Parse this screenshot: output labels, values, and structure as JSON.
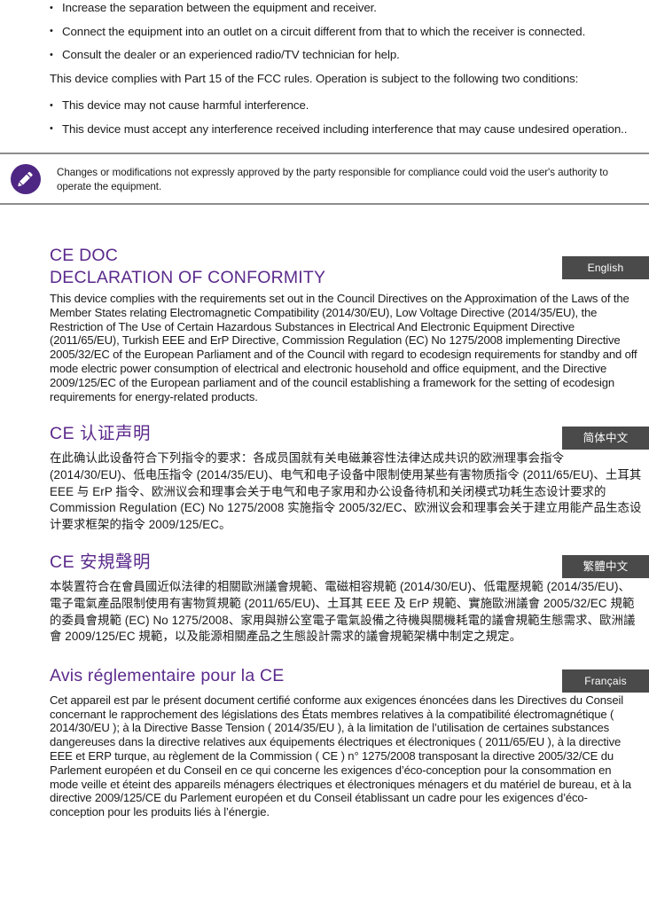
{
  "fcc": {
    "bullets": [
      "Increase the separation between the equipment and receiver.",
      "Connect the equipment into an outlet on a circuit different from that to which the receiver is connected.",
      "Consult the dealer or an experienced radio/TV technician for help."
    ],
    "compliance_paragraph": "This device complies with Part 15 of the FCC rules. Operation is subject to the following two conditions:",
    "conditions": [
      "This device may not cause harmful interference.",
      "This device must accept any interference received including interference that may cause undesired operation.."
    ]
  },
  "note": {
    "icon": "pencil-icon",
    "icon_background": "#4e2683",
    "text": "Changes or modifications not expressly approved by the party responsible for compliance could void the user's authority to operate the equipment."
  },
  "colors": {
    "heading_purple": "#5b2a8c",
    "badge_gray": "#4a4a4a",
    "rule_gray": "#8d8d8d"
  },
  "sections": [
    {
      "id": "ce-doc-english",
      "title_line1": "CE DOC",
      "title_line2": "DECLARATION OF CONFORMITY",
      "badge": "English",
      "body": "This device complies with the requirements set out in the Council Directives on the Approximation of the Laws of the Member States relating Electromagnetic Compatibility (2014/30/EU), Low Voltage Directive (2014/35/EU), the Restriction of The Use of Certain Hazardous Substances in Electrical And Electronic Equipment Directive (2011/65/EU), Turkish EEE and ErP Directive, Commission Regulation (EC) No 1275/2008 implementing Directive 2005/32/EC of the European Parliament and of the Council with regard to ecodesign requirements for standby and off mode electric power consumption of electrical and electronic household and office equipment, and the Directive 2009/125/EC of the European parliament and of the council establishing a framework for the setting of ecodesign requirements for energy-related products."
    },
    {
      "id": "ce-doc-simplified-chinese",
      "title": "CE 认证声明",
      "badge": "简体中文",
      "body": "在此确认此设备符合下列指令的要求：各成员国就有关电磁兼容性法律达成共识的欧洲理事会指令 (2014/30/EU)、低电压指令 (2014/35/EU)、电气和电子设备中限制使用某些有害物质指令 (2011/65/EU)、土耳其 EEE 与 ErP 指令、欧洲议会和理事会关于电气和电子家用和办公设备待机和关闭模式功耗生态设计要求的 Commission Regulation (EC) No 1275/2008 实施指令 2005/32/EC、欧洲议会和理事会关于建立用能产品生态设计要求框架的指令 2009/125/EC。"
    },
    {
      "id": "ce-doc-traditional-chinese",
      "title": "CE 安規聲明",
      "badge": "繁體中文",
      "body": "本裝置符合在會員國近似法律的相關歐洲議會規範、電磁相容規範 (2014/30/EU)、低電壓規範 (2014/35/EU)、電子電氣產品限制使用有害物質規範 (2011/65/EU)、土耳其 EEE 及 ErP 規範、實施歐洲議會 2005/32/EC 規範的委員會規範 (EC) No 1275/2008、家用與辦公室電子電氣設備之待機與關機耗電的議會規範生態需求、歐洲議會 2009/125/EC 規範，以及能源相關產品之生態設計需求的議會規範架構中制定之規定。"
    },
    {
      "id": "ce-doc-french",
      "title": "Avis réglementaire pour la CE",
      "badge": "Français",
      "body": "Cet appareil est par le présent document certifié conforme aux exigences énoncées dans les Directives du Conseil concernant le rapprochement des législations des États membres relatives à la compatibilité électromagnétique ( 2014/30/EU ); à la Directive Basse Tension ( 2014/35/EU ), à la limitation de l’utilisation de certaines substances dangereuses dans la directive relatives aux équipements électriques et électroniques ( 2011/65/EU ), à la directive EEE et ERP turque, au règlement de la Commission ( CE ) n° 1275/2008 transposant la directive 2005/32/CE du Parlement européen et du Conseil en ce qui concerne les exigences d’éco-conception pour la consommation en mode veille et éteint des appareils ménagers électriques et électroniques ménagers et du matériel de bureau, et à la directive 2009/125/CE du Parlement européen et du Conseil établissant un cadre pour les exigences d’éco-conception pour les produits liés à l’énergie."
    }
  ]
}
